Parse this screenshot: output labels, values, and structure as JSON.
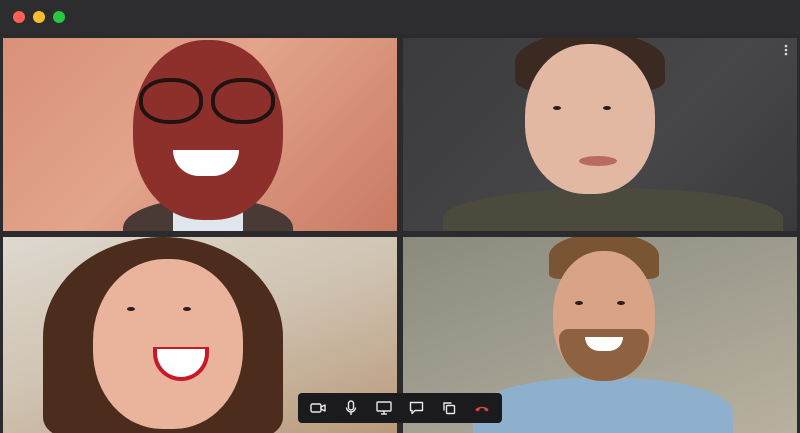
{
  "window": {
    "controls": [
      "close",
      "minimize",
      "maximize"
    ]
  },
  "participants": [
    {
      "tile": "top-left"
    },
    {
      "tile": "top-right",
      "menu_icon": "more-vertical-icon"
    },
    {
      "tile": "bottom-left"
    },
    {
      "tile": "bottom-right"
    }
  ],
  "toolbar": {
    "buttons": [
      {
        "icon": "video-camera-icon"
      },
      {
        "icon": "microphone-icon"
      },
      {
        "icon": "screen-share-icon"
      },
      {
        "icon": "chat-icon"
      },
      {
        "icon": "copy-icon"
      },
      {
        "icon": "end-call-icon",
        "color": "#e5453c"
      }
    ]
  },
  "colors": {
    "titlebar": "#2d2d30",
    "toolbar": "#1b1b1d",
    "end_call": "#e5453c",
    "close_dot": "#fe5f57",
    "minimize_dot": "#febc2e",
    "maximize_dot": "#28c840"
  }
}
